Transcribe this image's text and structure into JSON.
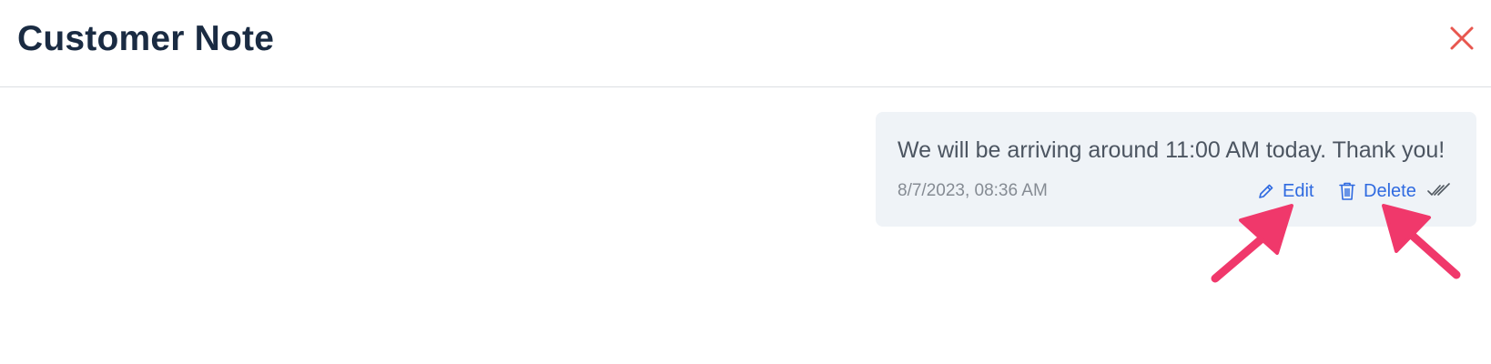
{
  "header": {
    "title": "Customer Note",
    "close_icon": "close-icon"
  },
  "note": {
    "text": "We will be arriving around 11:00 AM today. Thank you!",
    "timestamp": "8/7/2023, 08:36 AM",
    "edit_label": "Edit",
    "delete_label": "Delete",
    "edit_icon": "pencil-icon",
    "delete_icon": "trash-icon",
    "status_icon": "double-check-icon"
  },
  "annotations": {
    "arrow_color": "#f0386b"
  },
  "colors": {
    "title": "#1a2b42",
    "close": "#e8574f",
    "card_bg": "#eff3f7",
    "link": "#2f6ae0",
    "text": "#4c5561",
    "muted": "#858b93"
  }
}
